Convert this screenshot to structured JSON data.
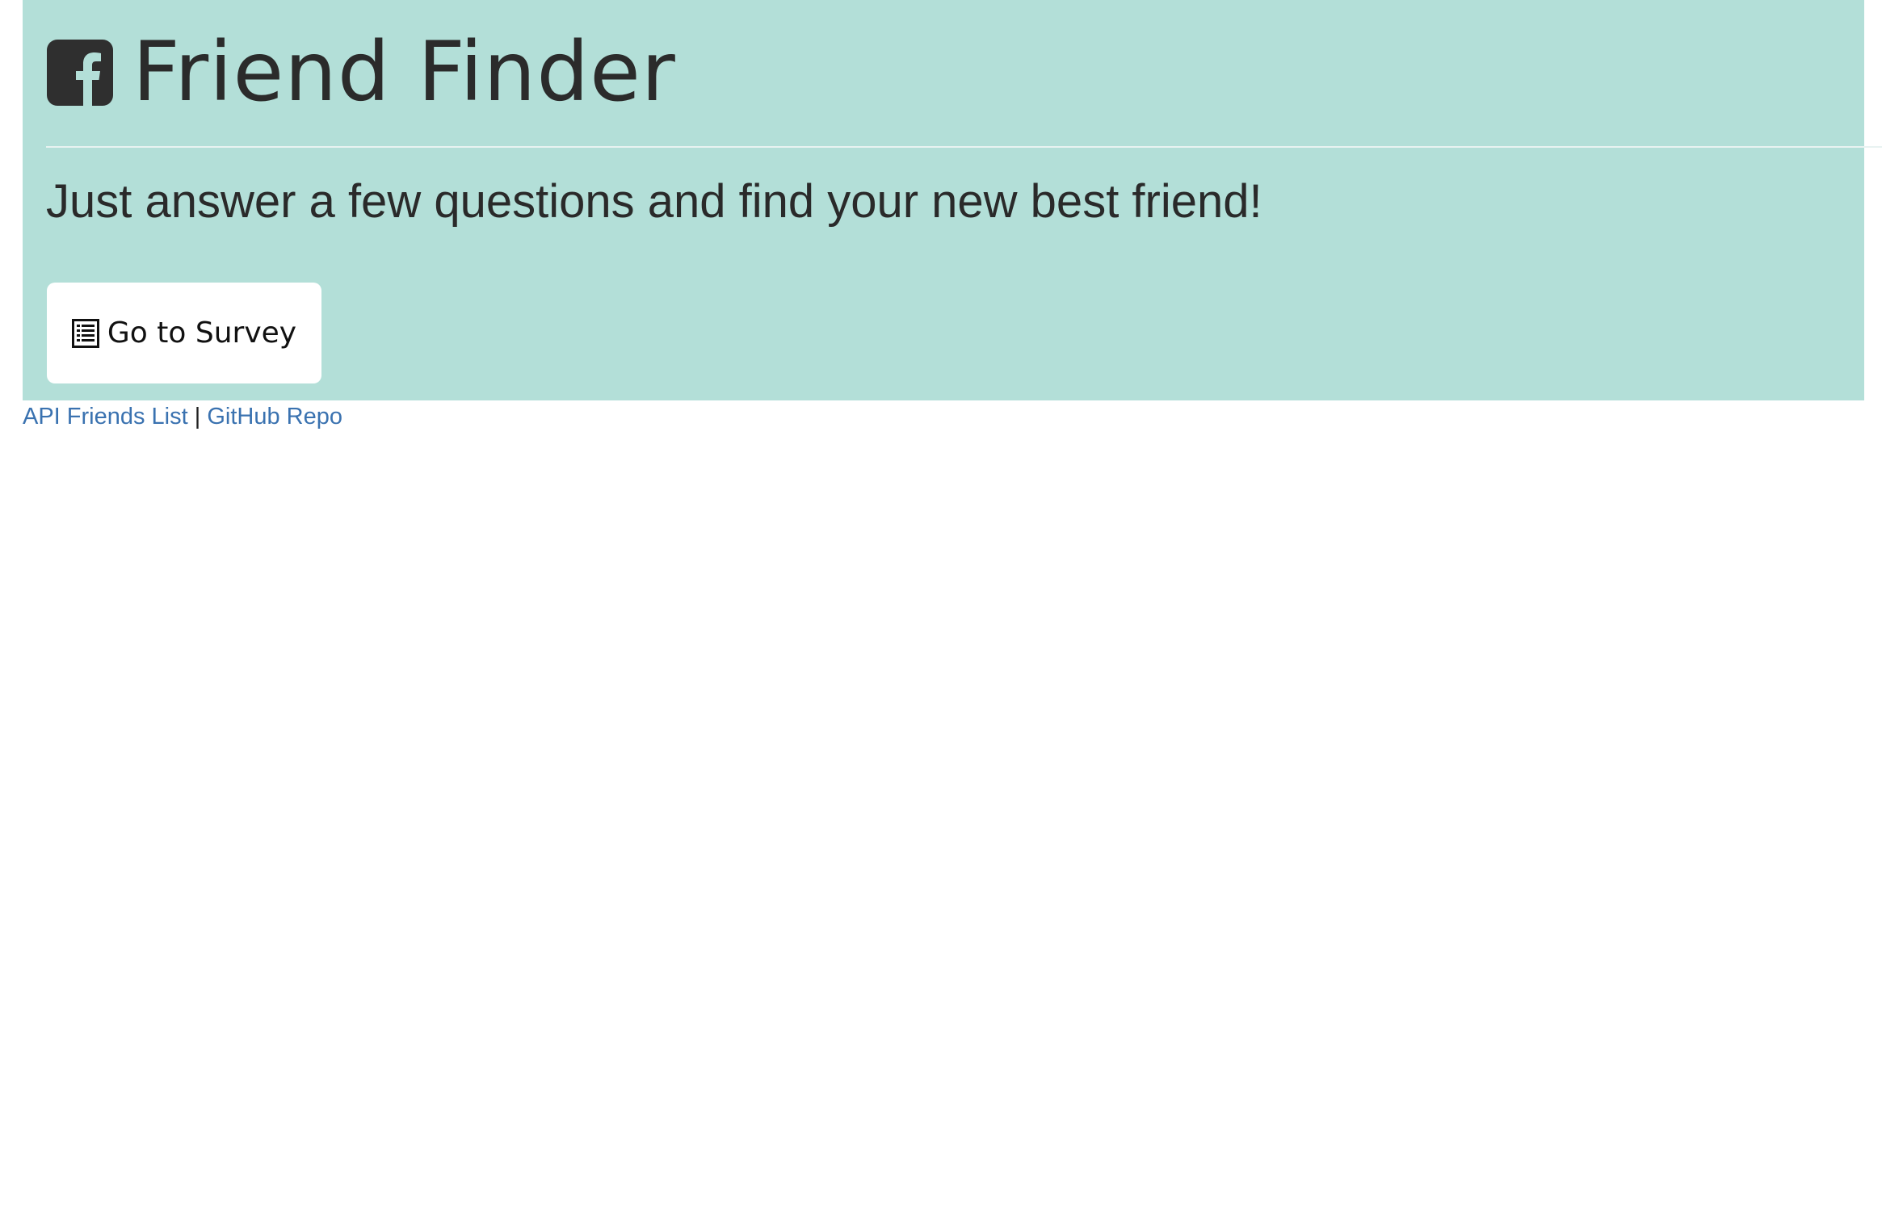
{
  "header": {
    "title": "Friend Finder",
    "brand_icon": "facebook-square-icon",
    "tagline": "Just answer a few questions and find your new best friend!"
  },
  "survey_button": {
    "icon": "list-alt-icon",
    "label": "Go to Survey"
  },
  "footer": {
    "api_link": "API Friends List",
    "separator": "|",
    "github_link": "GitHub Repo"
  },
  "colors": {
    "jumbotron_bg": "#b3dfd8",
    "link": "#3a72b0",
    "text": "#2b2b2b"
  }
}
